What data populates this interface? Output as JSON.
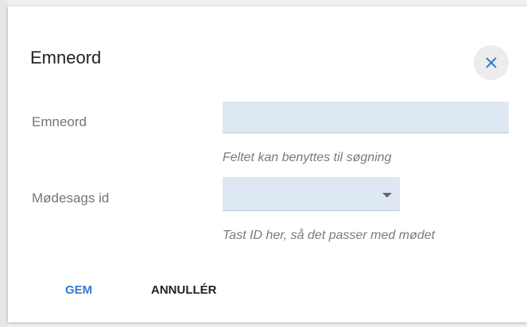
{
  "dialog": {
    "title": "Emneord",
    "close_icon": "close-icon"
  },
  "fields": {
    "keyword": {
      "label": "Emneord",
      "value": "",
      "hint": "Feltet kan benyttes til søgning"
    },
    "meeting_case_id": {
      "label": "Mødesags id",
      "selected": "",
      "hint": "Tast ID her, så det passer med mødet"
    }
  },
  "actions": {
    "save_label": "GEM",
    "cancel_label": "ANNULLÉR"
  },
  "colors": {
    "accent": "#2f7fd0",
    "input_bg": "#dde8f3",
    "close_icon": "#2f7fd0"
  }
}
